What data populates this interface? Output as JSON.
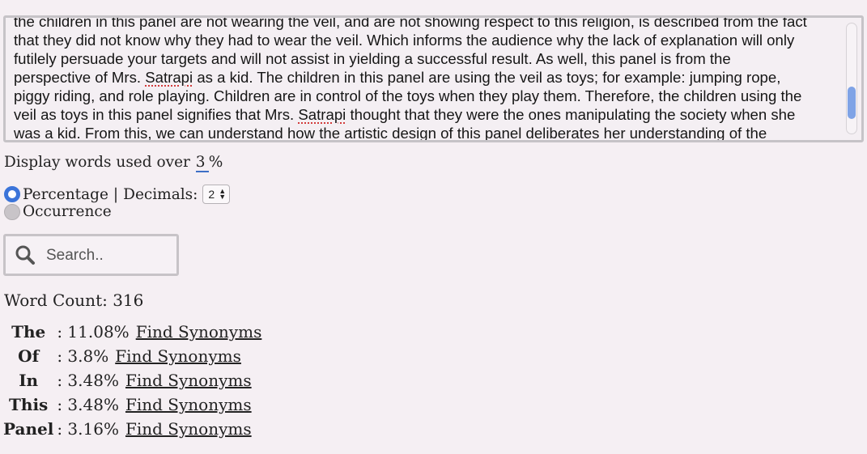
{
  "essay": {
    "lines": [
      "the children in this panel are not wearing the veil, and are not showing respect to this religion, is described from the fact",
      "that they did not know why they had to wear the veil. Which informs the audience why the lack of explanation will only",
      "futilely persuade your targets and will not assist in yielding a successful result. As well, this panel is from the",
      "perspective of Mrs. Satrapi as a kid. The children in this panel are using the veil as toys; for example: jumping rope,",
      "piggy riding, and role playing. Children are in control of the toys when they play them. Therefore, the children using the",
      "veil as toys in this panel signifies that Mrs. Satrapi thought that they were the ones manipulating the society when she",
      "was a kid. From this, we can understand how the artistic design of this panel deliberates her understanding of the"
    ],
    "misspelled_word": "Satrapi"
  },
  "threshold": {
    "prefix": "Display words used over",
    "value": "3",
    "suffix": "%"
  },
  "mode": {
    "percentage_label": "Percentage",
    "separator": "|",
    "decimals_label": "Decimals:",
    "decimals_value": "2",
    "occurrence_label": "Occurrence",
    "selected": "Percentage"
  },
  "search": {
    "placeholder": "Search.."
  },
  "word_count": {
    "label": "Word Count: 316"
  },
  "words": [
    {
      "word": "The",
      "value": ": 11.08%",
      "link": "Find Synonyms"
    },
    {
      "word": "Of",
      "value": ": 3.8%",
      "link": "Find Synonyms"
    },
    {
      "word": "In",
      "value": ": 3.48%",
      "link": "Find Synonyms"
    },
    {
      "word": "This",
      "value": ": 3.48%",
      "link": "Find Synonyms"
    },
    {
      "word": "Panel",
      "value": ": 3.16%",
      "link": "Find Synonyms"
    }
  ],
  "colors": {
    "background": "#f5eff3",
    "accent": "#3b74d9",
    "scroll_thumb": "#7fa3e6"
  },
  "icons": {
    "search": "magnifier-icon",
    "stepper": "up-down-arrows"
  }
}
